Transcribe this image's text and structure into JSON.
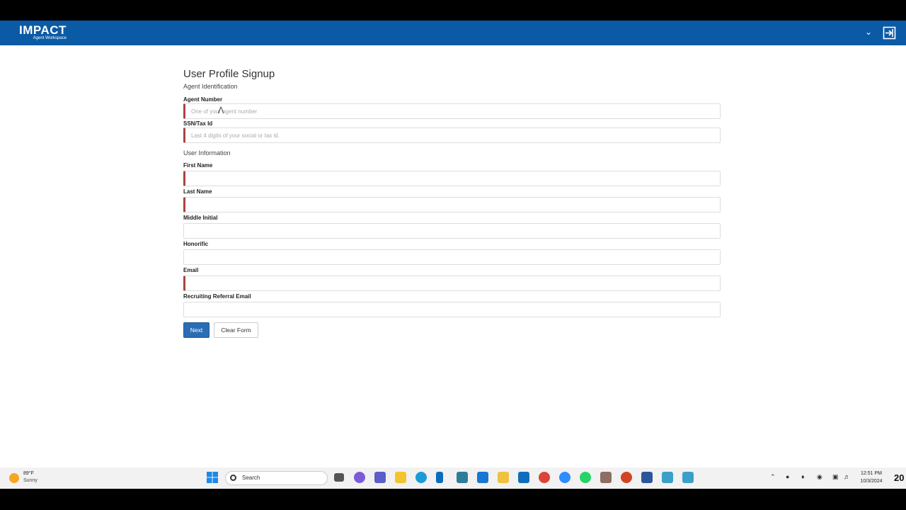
{
  "header": {
    "brand_name": "IMPACT",
    "brand_sub": "Agent Workspace",
    "chevron_icon": "chevron-down-icon",
    "exit_icon": "sign-out-icon"
  },
  "form": {
    "title": "User Profile Signup",
    "section_agent": "Agent Identification",
    "agent_number": {
      "label": "Agent Number",
      "placeholder": "One of your agent number",
      "value": ""
    },
    "ssn": {
      "label": "SSN/Tax Id",
      "placeholder": "Last 4 digits of your social or tax id.",
      "value": ""
    },
    "section_user": "User Information",
    "first_name": {
      "label": "First Name",
      "value": ""
    },
    "last_name": {
      "label": "Last Name",
      "value": ""
    },
    "middle_initial": {
      "label": "Middle Initial",
      "value": ""
    },
    "honorific": {
      "label": "Honorific",
      "value": ""
    },
    "email": {
      "label": "Email",
      "value": ""
    },
    "referral_email": {
      "label": "Recruiting Referral Email",
      "value": ""
    },
    "next_label": "Next",
    "clear_label": "Clear Form"
  },
  "taskbar": {
    "weather_temp": "89°F",
    "weather_cond": "Sunny",
    "search_text": "Search",
    "time": "12:51 PM",
    "date": "10/3/2024",
    "edge_text": "20"
  },
  "colors": {
    "header_blue": "#0b5aa5",
    "required_red": "#a94442",
    "button_blue": "#2a6db5"
  }
}
